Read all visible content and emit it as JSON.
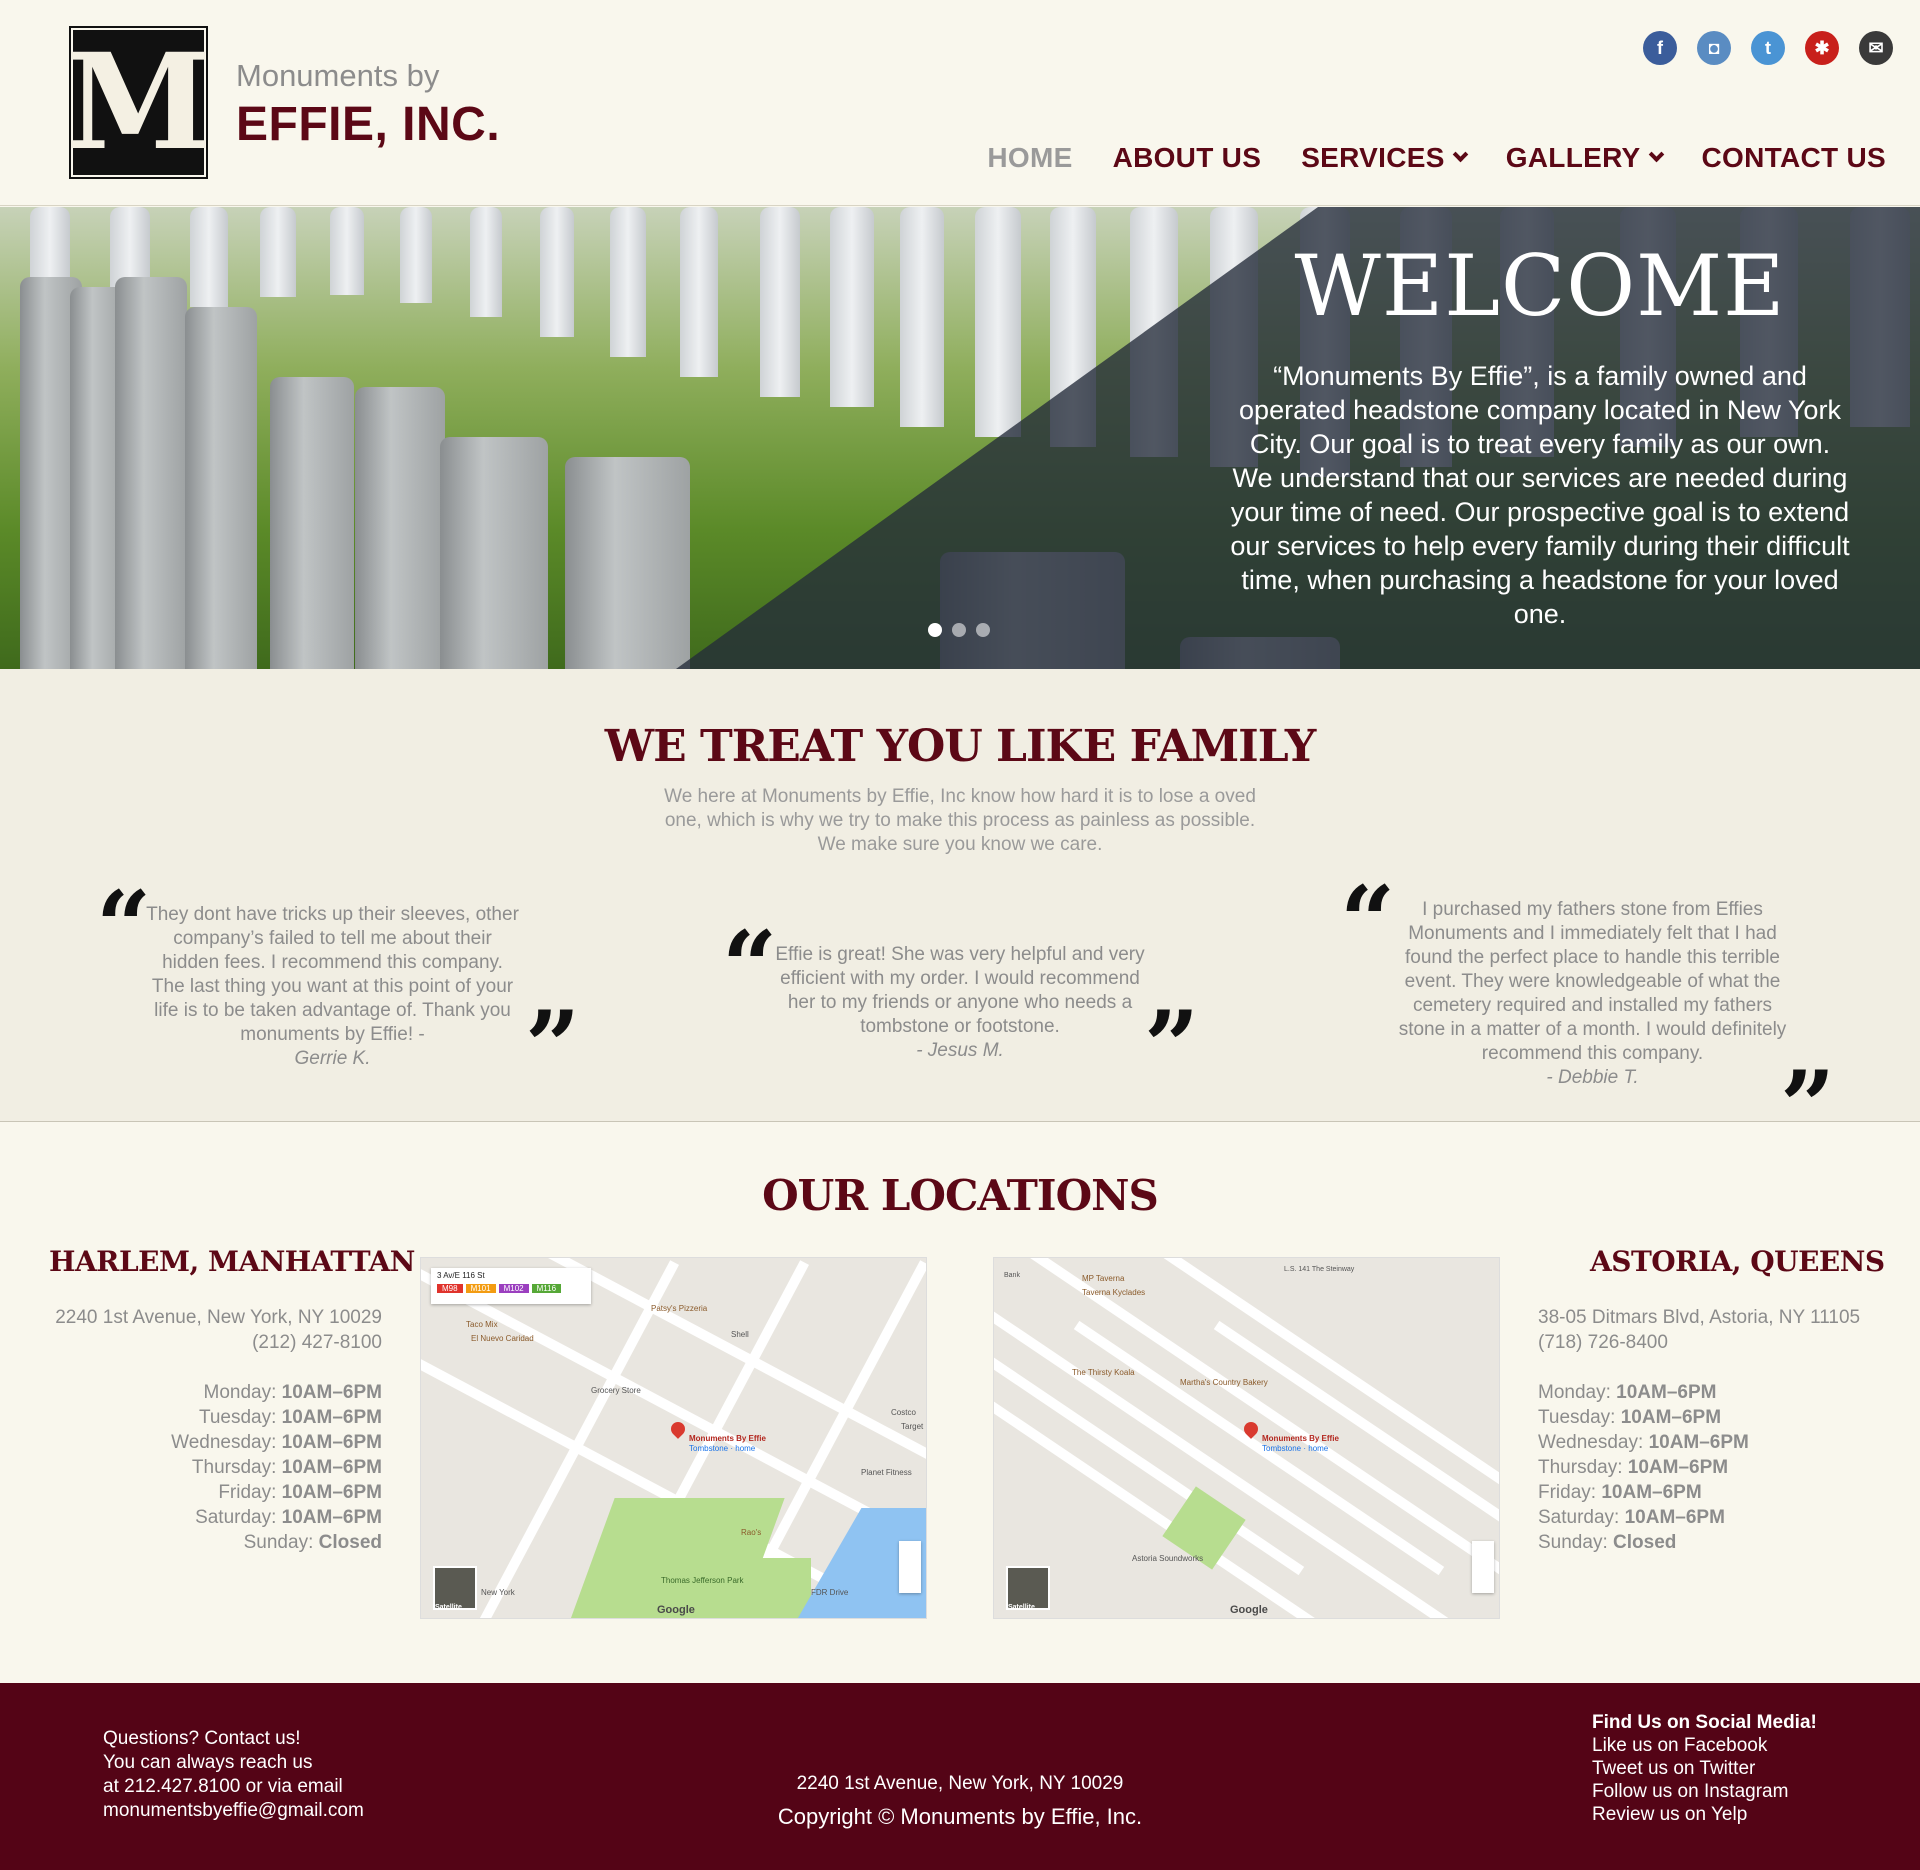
{
  "brand": {
    "logo_letter": "M",
    "small": "Monuments by",
    "big": "EFFIE, INC."
  },
  "socials": [
    {
      "icon": "facebook-icon",
      "glyph": "f"
    },
    {
      "icon": "instagram-icon",
      "glyph": "◘"
    },
    {
      "icon": "twitter-icon",
      "glyph": "t"
    },
    {
      "icon": "yelp-icon",
      "glyph": "✱"
    },
    {
      "icon": "email-icon",
      "glyph": "✉"
    }
  ],
  "nav": {
    "home": "HOME",
    "about": "ABOUT US",
    "services": "SERVICES",
    "gallery": "GALLERY",
    "contact": "CONTACT US"
  },
  "hero": {
    "title": "WELCOME",
    "text": "“Monuments By Effie”, is a family owned and operated headstone company located in New York City. Our goal is to treat every family as our own. We understand that our services are needed during your time of need. Our prospective goal is to extend our services to help every family during their difficult time, when purchasing a headstone for your loved one.",
    "slide_count": 3,
    "active_slide": 1
  },
  "family": {
    "heading": "WE TREAT YOU LIKE FAMILY",
    "intro": "We here at Monuments by Effie, Inc know how hard it is to lose a oved one, which is why we try to make this process as painless as possible. We make sure you know we care.",
    "testimonials": [
      {
        "text": "They dont have tricks up their sleeves, other company’s failed to tell me about their hidden fees. I recommend this company. The last thing you want at this point of your life is to be taken advantage of. Thank you monuments by Effie! -",
        "author": "Gerrie K."
      },
      {
        "text": "Effie is great! She was very helpful and very efficient with my order. I would recommend her to my friends or anyone who needs a tombstone or footstone.",
        "author": "- Jesus M."
      },
      {
        "text": "I purchased my fathers stone from Effies Monuments and I immediately felt that I had found the perfect place to handle this terrible event. They were knowledgeable of what the cemetery required and installed my fathers stone in a matter of a month.  I would definitely recommend this company.",
        "author": "- Debbie T."
      }
    ],
    "open_quote": "“",
    "close_quote": "”"
  },
  "locations": {
    "heading": "OUR LOCATIONS",
    "harlem": {
      "title": "HARLEM, MANHATTAN",
      "address": "2240 1st Avenue, New York, NY 10029",
      "phone": "(212) 427-8100",
      "hours": [
        {
          "day": "Monday:",
          "time": "10AM–6PM"
        },
        {
          "day": "Tuesday:",
          "time": "10AM–6PM"
        },
        {
          "day": "Wednesday:",
          "time": "10AM–6PM"
        },
        {
          "day": "Thursday:",
          "time": "10AM–6PM"
        },
        {
          "day": "Friday:",
          "time": "10AM–6PM"
        },
        {
          "day": "Saturday:",
          "time": "10AM–6PM"
        },
        {
          "day": "Sunday:",
          "time": "Closed"
        }
      ],
      "map_label": "Monuments By Effie",
      "map_sub": "Tombstone · home",
      "map_search": "3 Av/E 116 St",
      "map_places": [
        "Patsy's Pizzeria",
        "Shell",
        "Grocery Store",
        "Costco",
        "Target",
        "Planet Fitness",
        "Rao's",
        "Thomas Jefferson Park",
        "FDR Drive",
        "El Nuevo Caridad",
        "Taco Mix",
        "New York"
      ],
      "bus_routes": [
        "M98",
        "M101",
        "M102",
        "M116"
      ],
      "map_brand": "Google",
      "map_satellite": "Satellite"
    },
    "astoria": {
      "title": "ASTORIA, QUEENS",
      "address": "38-05 Ditmars Blvd, Astoria, NY 11105",
      "phone": "(718) 726-8400",
      "hours": [
        {
          "day": "Monday:",
          "time": "10AM–6PM"
        },
        {
          "day": "Tuesday:",
          "time": "10AM–6PM"
        },
        {
          "day": "Wednesday:",
          "time": "10AM–6PM"
        },
        {
          "day": "Thursday:",
          "time": "10AM–6PM"
        },
        {
          "day": "Friday:",
          "time": "10AM–6PM"
        },
        {
          "day": "Saturday:",
          "time": "10AM–6PM"
        },
        {
          "day": "Sunday:",
          "time": "Closed"
        }
      ],
      "map_label": "Monuments By Effie",
      "map_sub": "Tombstone · home",
      "map_places": [
        "MP Taverna",
        "Taverna Kyclades",
        "The Thirsty Koala",
        "Martha's Country Bakery",
        "Astoria Soundworks",
        "L.S. 141 The Steinway",
        "Bank"
      ],
      "map_brand": "Google",
      "map_satellite": "Satellite"
    }
  },
  "footer": {
    "left": [
      "Questions? Contact us!",
      "You can always reach us",
      "at 212.427.8100 or via email",
      "monumentsbyeffie@gmail.com"
    ],
    "center_address": "2240 1st Avenue, New York, NY 10029",
    "copyright": "Copyright © Monuments by Effie, Inc.",
    "social_heading": "Find Us on Social Media!",
    "social_links": [
      "Like us on Facebook",
      "Tweet us on Twitter",
      "Follow us on Instagram",
      "Review us on Yelp"
    ]
  },
  "colors": {
    "brand": "#5c0816",
    "footer": "#540416",
    "page_bg": "#f9f7ed",
    "section_bg": "#f1eee3"
  }
}
